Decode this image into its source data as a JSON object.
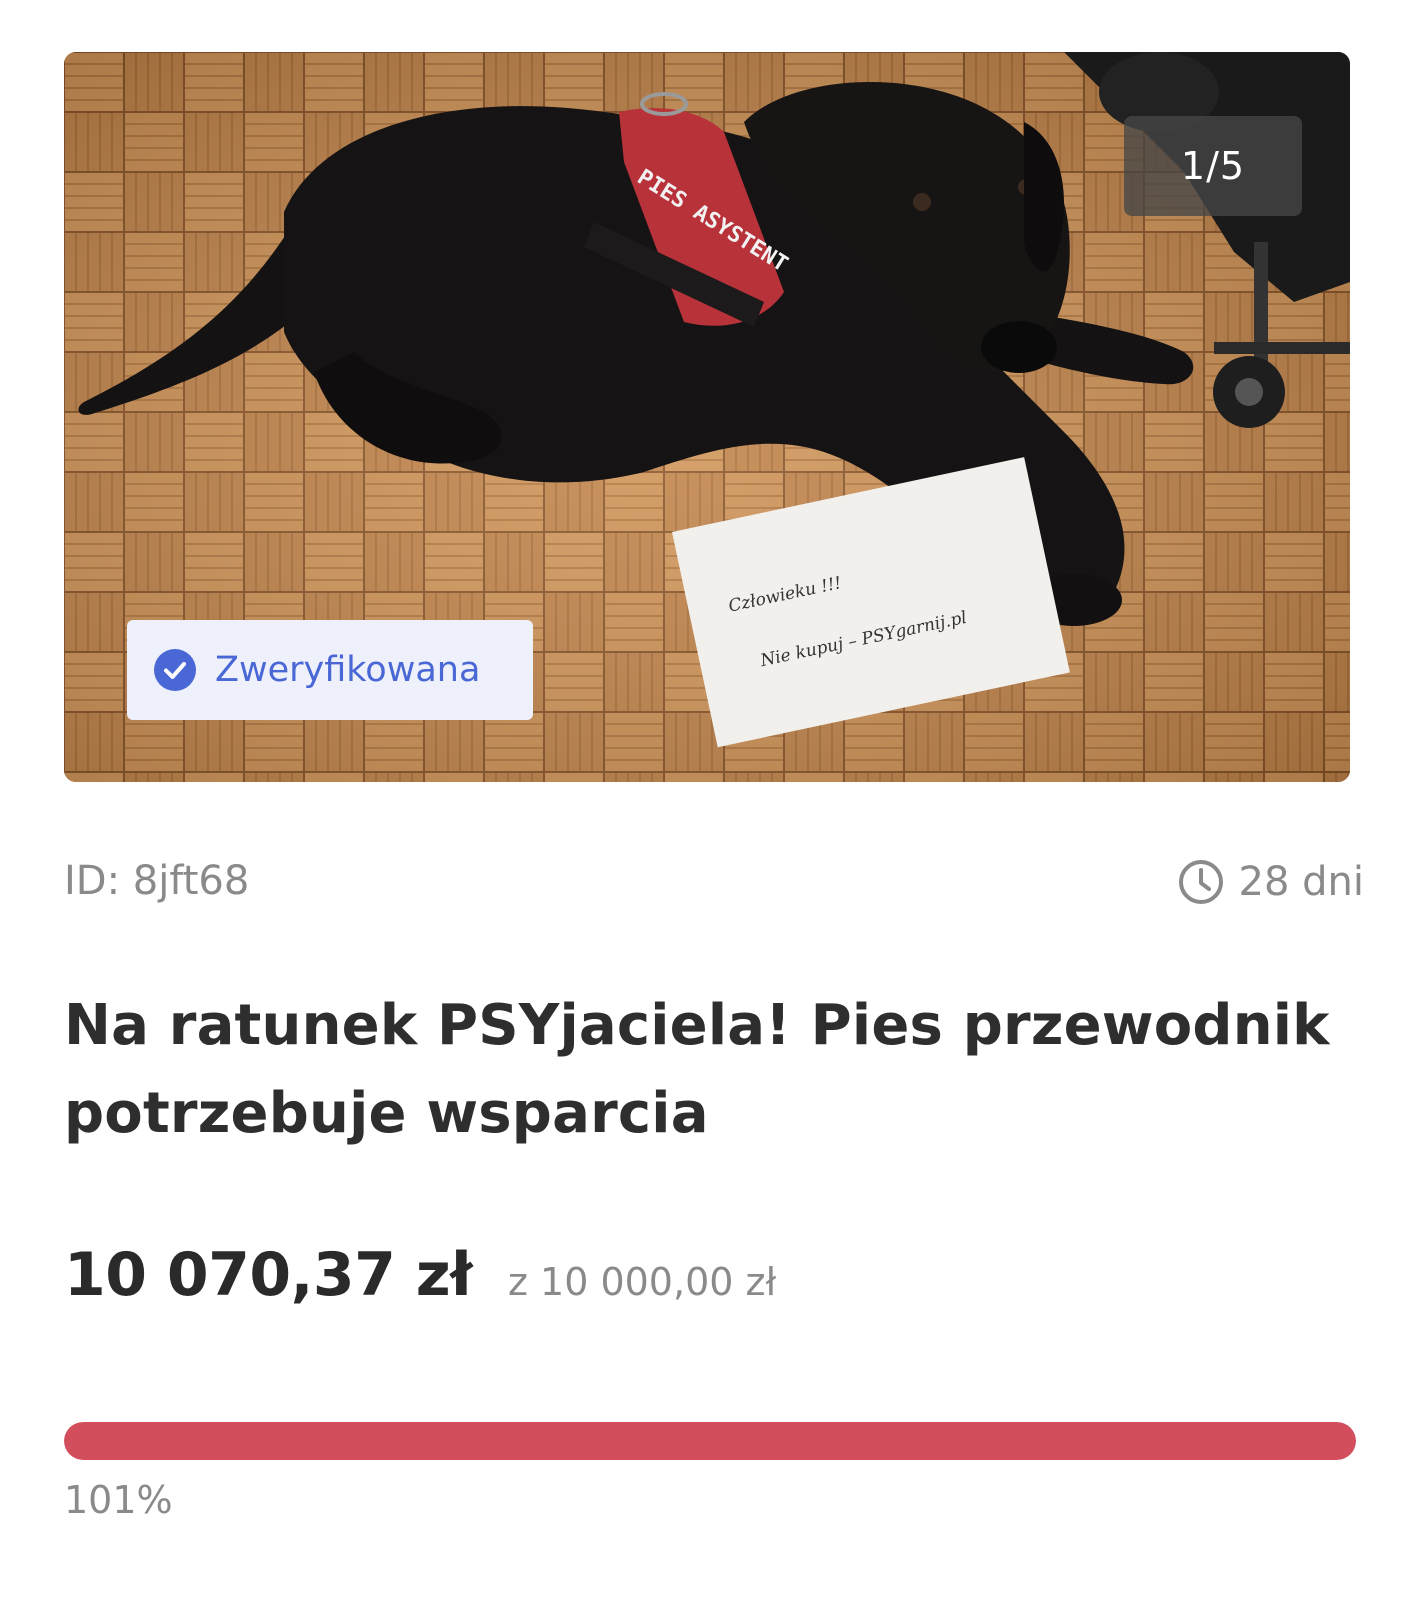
{
  "gallery": {
    "counter": "1/5",
    "image_label": "PIES ASYSTENT",
    "note_line1": "Człowieku !!!",
    "note_line2": "Nie kupuj – PSYgarnij.pl"
  },
  "badge": {
    "label": "Zweryfikowana",
    "icon": "check-circle-icon"
  },
  "meta": {
    "id_text": "ID: 8jft68",
    "time_left": "28 dni",
    "time_icon": "clock-icon"
  },
  "campaign": {
    "title": "Na ratunek PSYjaciela! Pies przewodnik potrzebuje wsparcia",
    "raised": "10 070,37 zł",
    "goal": "z 10 000,00 zł",
    "progress_percent_label": "101%",
    "progress_value": 1.0
  },
  "colors": {
    "accent": "#d34e5c",
    "verified": "#4a67d6",
    "muted_text": "#8a8a8a"
  }
}
